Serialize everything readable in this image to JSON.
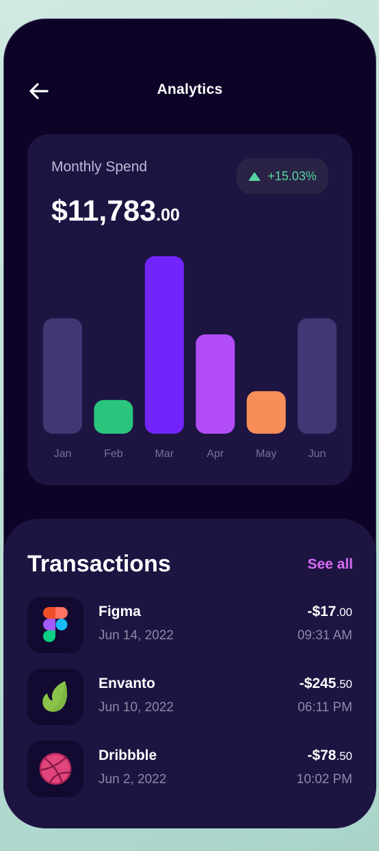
{
  "header": {
    "title": "Analytics",
    "back_icon": "arrow-left-icon"
  },
  "spend": {
    "label": "Monthly Spend",
    "amount_main": "$11,783",
    "amount_cents": ".00",
    "change": "+15.03%",
    "change_icon": "triangle-up-icon"
  },
  "chart_data": {
    "type": "bar",
    "categories": [
      "Jan",
      "Feb",
      "Mar",
      "Apr",
      "May",
      "Jun"
    ],
    "values": [
      65,
      19,
      100,
      56,
      24,
      65
    ],
    "colors": [
      "#433674",
      "#2ac47c",
      "#7224fb",
      "#b14cf7",
      "#f78e5a",
      "#433674"
    ],
    "title": "",
    "xlabel": "",
    "ylabel": "",
    "ylim": [
      0,
      100
    ],
    "grid": false
  },
  "transactions": {
    "title": "Transactions",
    "see_all": "See all",
    "items": [
      {
        "name": "Figma",
        "date": "Jun 14, 2022",
        "amount": "-$17",
        "cents": ".00",
        "time": "09:31 AM",
        "icon": "figma-icon"
      },
      {
        "name": "Envanto",
        "date": "Jun 10, 2022",
        "amount": "-$245",
        "cents": ".50",
        "time": "06:11 PM",
        "icon": "envato-icon"
      },
      {
        "name": "Dribbble",
        "date": "Jun 2, 2022",
        "amount": "-$78",
        "cents": ".50",
        "time": "10:02 PM",
        "icon": "dribbble-icon"
      }
    ]
  }
}
